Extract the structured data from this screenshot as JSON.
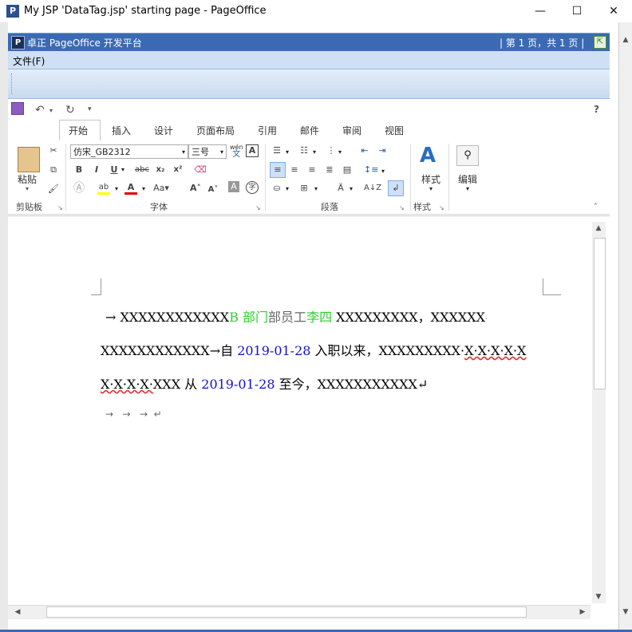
{
  "window": {
    "title": "My JSP 'DataTag.jsp' starting page - PageOffice",
    "app_icon": "P",
    "minimize": "—",
    "maximize": "☐",
    "close": "✕"
  },
  "pageoffice": {
    "logo": "P",
    "title": "卓正 PageOffice 开发平台",
    "page_info": "| 第 1 页，共 1 页 |",
    "fullscreen_icon": "expand-icon"
  },
  "menu": {
    "file": "文件(F)"
  },
  "qat": {
    "save_icon": "save-icon",
    "undo_icon": "undo-icon",
    "redo_icon": "redo-icon",
    "help": "?"
  },
  "tabs": [
    "开始",
    "插入",
    "设计",
    "页面布局",
    "引用",
    "邮件",
    "审阅",
    "视图"
  ],
  "ribbon": {
    "clipboard": {
      "paste": "粘贴",
      "label": "剪贴板"
    },
    "font": {
      "font_name": "仿宋_GB2312",
      "font_size": "三号",
      "wen": "wén",
      "wen_char": "文",
      "label": "字体"
    },
    "paragraph": {
      "label": "段落"
    },
    "styles": {
      "styles_button": "样式",
      "label": "样式"
    },
    "editing": {
      "edit_button": "编辑"
    }
  },
  "document": {
    "line1": {
      "lead": "→ XXXXXXXXXXXX",
      "dept": "B 部门",
      "mid": "部员工",
      "name": "李四",
      "tail": " XXXXXXXXX，XXXXXX"
    },
    "line2": {
      "lead": "XXXXXXXXXXXX→自 ",
      "date": "2019-01-28",
      "mid": " 入职以来，XXXXXXXXX·",
      "tail": "X·X·X·X·X"
    },
    "line3": {
      "lead": "X·X·X·X·",
      "lead2": "XXX 从 ",
      "date": "2019-01-28",
      "tail": " 至今，XXXXXXXXXXX↵"
    },
    "line4": "→   →   →  ↵"
  }
}
